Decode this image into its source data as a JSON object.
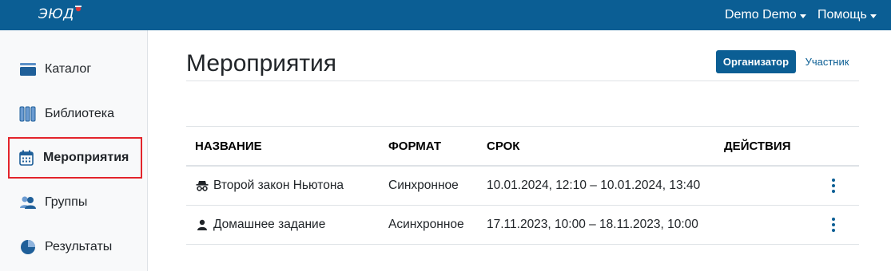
{
  "app": {
    "logo_text": "ЭЮД"
  },
  "topbar": {
    "user_menu": "Demo Demo",
    "help_menu": "Помощь"
  },
  "sidebar": {
    "items": [
      {
        "label": "Каталог",
        "icon": "catalog-icon"
      },
      {
        "label": "Библиотека",
        "icon": "library-icon"
      },
      {
        "label": "Мероприятия",
        "icon": "calendar-icon",
        "active": true
      },
      {
        "label": "Группы",
        "icon": "users-icon"
      },
      {
        "label": "Результаты",
        "icon": "pie-chart-icon"
      }
    ]
  },
  "main": {
    "title": "Мероприятия",
    "role_tabs": {
      "organizer": "Организатор",
      "participant": "Участник"
    },
    "table": {
      "headers": {
        "name": "НАЗВАНИЕ",
        "format": "ФОРМАТ",
        "term": "СРОК",
        "actions": "ДЕЙСТВИЯ"
      },
      "rows": [
        {
          "icon": "incognito-icon",
          "name": "Второй закон Ньютона",
          "format": "Синхронное",
          "term": "10.01.2024, 12:10 – 10.01.2024, 13:40"
        },
        {
          "icon": "person-icon",
          "name": "Домашнее задание",
          "format": "Асинхронное",
          "term": "17.11.2023, 10:00 – 18.11.2023, 10:00"
        }
      ]
    }
  },
  "colors": {
    "brand": "#0b5e94",
    "highlight": "#e3242b"
  }
}
